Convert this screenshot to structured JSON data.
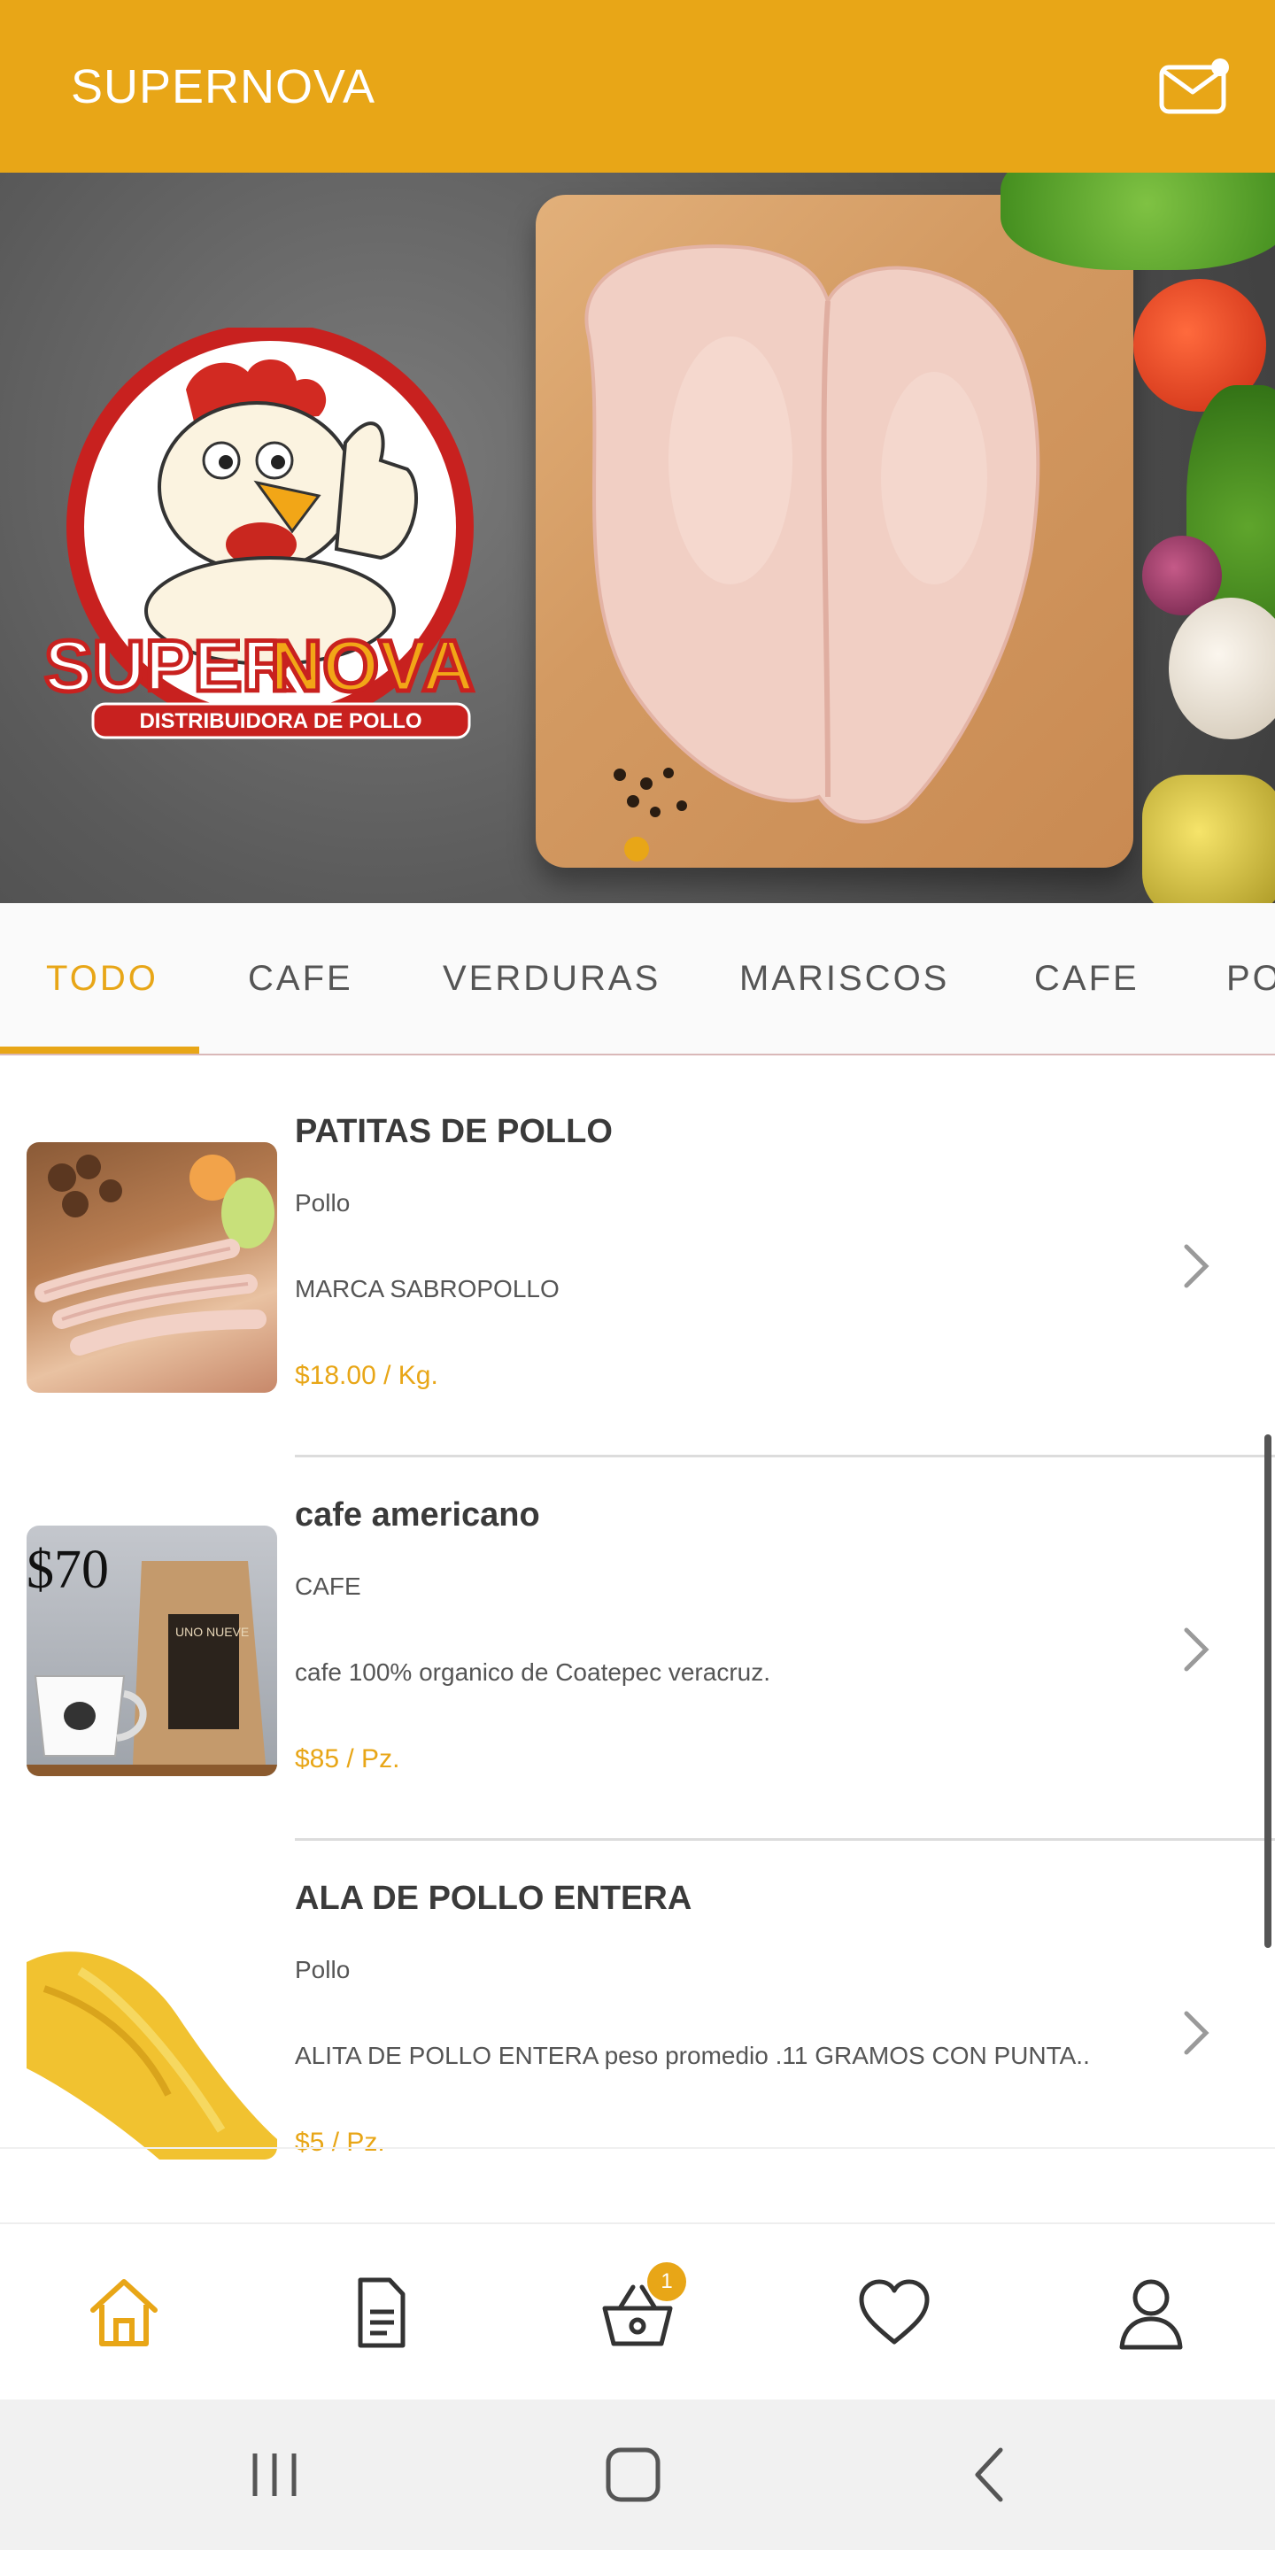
{
  "app": {
    "title": "SUPERNOVA",
    "brand_color": "#e8a617"
  },
  "header": {
    "mail_icon": "mail-notification-icon"
  },
  "banner": {
    "logo_text_1": "SUPER",
    "logo_text_2": "NOVA",
    "logo_subtitle": "DISTRIBUIDORA DE POLLO",
    "active_slide_index": 0
  },
  "tabs": [
    {
      "label": "TODO",
      "active": true
    },
    {
      "label": "CAFE",
      "active": false
    },
    {
      "label": "VERDURAS",
      "active": false
    },
    {
      "label": "MARISCOS",
      "active": false
    },
    {
      "label": "CAFE",
      "active": false
    },
    {
      "label": "PO",
      "active": false
    }
  ],
  "products": [
    {
      "name": "PATITAS DE POLLO",
      "category": "Pollo",
      "description": "MARCA SABROPOLLO",
      "price": "$18.00 / Kg."
    },
    {
      "name": "cafe americano",
      "category": "CAFE",
      "description": "cafe 100% organico de Coatepec veracruz.",
      "price": "$85 / Pz.",
      "image_text": "$70",
      "image_caption": "UNO NUEVE"
    },
    {
      "name": "ALA DE POLLO ENTERA",
      "category": "Pollo",
      "description": "ALITA DE POLLO ENTERA peso promedio .11 GRAMOS CON PUNTA..",
      "price": "$5 / Pz."
    }
  ],
  "bottom_nav": [
    {
      "icon": "home-icon",
      "active": true
    },
    {
      "icon": "document-icon",
      "active": false
    },
    {
      "icon": "basket-icon",
      "active": false,
      "badge": "1"
    },
    {
      "icon": "heart-icon",
      "active": false
    },
    {
      "icon": "user-icon",
      "active": false
    }
  ],
  "system_nav": [
    "recent-apps-icon",
    "home-circle-icon",
    "back-icon"
  ]
}
